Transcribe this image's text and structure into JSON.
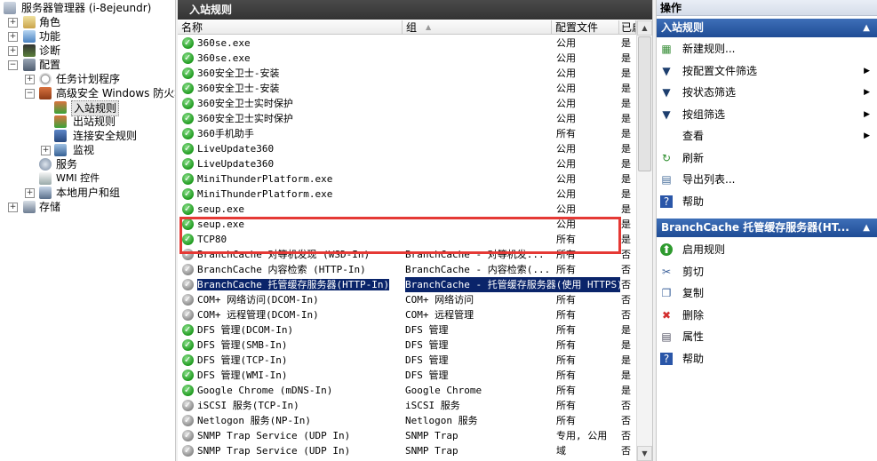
{
  "tree": {
    "root": "服务器管理器 (i-8ejeundr)",
    "items": [
      "角色",
      "功能",
      "诊断",
      "配置",
      "任务计划程序",
      "高级安全 Windows 防火墙",
      "入站规则",
      "出站规则",
      "连接安全规则",
      "监视",
      "服务",
      "WMI 控件",
      "本地用户和组",
      "存储"
    ]
  },
  "center": {
    "title": "入站规则",
    "columns": [
      "名称",
      "组",
      "配置文件",
      "已启用"
    ],
    "rows": [
      {
        "name": "360se.exe",
        "group": "",
        "profile": "公用",
        "enabled": "是",
        "icon": "ok"
      },
      {
        "name": "360se.exe",
        "group": "",
        "profile": "公用",
        "enabled": "是",
        "icon": "ok"
      },
      {
        "name": "360安全卫士-安装",
        "group": "",
        "profile": "公用",
        "enabled": "是",
        "icon": "ok"
      },
      {
        "name": "360安全卫士-安装",
        "group": "",
        "profile": "公用",
        "enabled": "是",
        "icon": "ok"
      },
      {
        "name": "360安全卫士实时保护",
        "group": "",
        "profile": "公用",
        "enabled": "是",
        "icon": "ok"
      },
      {
        "name": "360安全卫士实时保护",
        "group": "",
        "profile": "公用",
        "enabled": "是",
        "icon": "ok"
      },
      {
        "name": "360手机助手",
        "group": "",
        "profile": "所有",
        "enabled": "是",
        "icon": "ok"
      },
      {
        "name": "LiveUpdate360",
        "group": "",
        "profile": "公用",
        "enabled": "是",
        "icon": "ok"
      },
      {
        "name": "LiveUpdate360",
        "group": "",
        "profile": "公用",
        "enabled": "是",
        "icon": "ok"
      },
      {
        "name": "MiniThunderPlatform.exe",
        "group": "",
        "profile": "公用",
        "enabled": "是",
        "icon": "ok"
      },
      {
        "name": "MiniThunderPlatform.exe",
        "group": "",
        "profile": "公用",
        "enabled": "是",
        "icon": "ok"
      },
      {
        "name": "seup.exe",
        "group": "",
        "profile": "公用",
        "enabled": "是",
        "icon": "ok"
      },
      {
        "name": "seup.exe",
        "group": "",
        "profile": "公用",
        "enabled": "是",
        "icon": "ok"
      },
      {
        "name": "TCP80",
        "group": "",
        "profile": "所有",
        "enabled": "是",
        "icon": "ok"
      },
      {
        "name": "BranchCache 对等机发现 (WSD-In)",
        "group": "BranchCache - 对等机发...",
        "profile": "所有",
        "enabled": "否",
        "icon": "gray"
      },
      {
        "name": "BranchCache 内容检索 (HTTP-In)",
        "group": "BranchCache - 内容检索(...",
        "profile": "所有",
        "enabled": "否",
        "icon": "gray"
      },
      {
        "name": "BranchCache 托管缓存服务器(HTTP-In)",
        "group": "BranchCache - 托管缓存服务器(使用 HTTPS)",
        "profile": "",
        "enabled": "否",
        "icon": "gray",
        "selected": true
      },
      {
        "name": "COM+ 网络访问(DCOM-In)",
        "group": "COM+ 网络访问",
        "profile": "所有",
        "enabled": "否",
        "icon": "gray"
      },
      {
        "name": "COM+ 远程管理(DCOM-In)",
        "group": "COM+ 远程管理",
        "profile": "所有",
        "enabled": "否",
        "icon": "gray"
      },
      {
        "name": "DFS 管理(DCOM-In)",
        "group": "DFS 管理",
        "profile": "所有",
        "enabled": "是",
        "icon": "ok"
      },
      {
        "name": "DFS 管理(SMB-In)",
        "group": "DFS 管理",
        "profile": "所有",
        "enabled": "是",
        "icon": "ok"
      },
      {
        "name": "DFS 管理(TCP-In)",
        "group": "DFS 管理",
        "profile": "所有",
        "enabled": "是",
        "icon": "ok"
      },
      {
        "name": "DFS 管理(WMI-In)",
        "group": "DFS 管理",
        "profile": "所有",
        "enabled": "是",
        "icon": "ok"
      },
      {
        "name": "Google Chrome (mDNS-In)",
        "group": "Google Chrome",
        "profile": "所有",
        "enabled": "是",
        "icon": "ok"
      },
      {
        "name": "iSCSI 服务(TCP-In)",
        "group": "iSCSI 服务",
        "profile": "所有",
        "enabled": "否",
        "icon": "gray"
      },
      {
        "name": "Netlogon 服务(NP-In)",
        "group": "Netlogon 服务",
        "profile": "所有",
        "enabled": "否",
        "icon": "gray"
      },
      {
        "name": "SNMP Trap Service (UDP In)",
        "group": "SNMP Trap",
        "profile": "专用, 公用",
        "enabled": "否",
        "icon": "gray"
      },
      {
        "name": "SNMP Trap Service (UDP In)",
        "group": "SNMP Trap",
        "profile": "域",
        "enabled": "否",
        "icon": "gray"
      }
    ]
  },
  "actions": {
    "title": "操作",
    "section1": "入站规则",
    "section1_items": [
      {
        "label": "新建规则...",
        "icon": "new-rule-icon",
        "arrow": false
      },
      {
        "label": "按配置文件筛选",
        "icon": "filter-icon",
        "arrow": true
      },
      {
        "label": "按状态筛选",
        "icon": "filter-icon",
        "arrow": true
      },
      {
        "label": "按组筛选",
        "icon": "filter-icon",
        "arrow": true
      },
      {
        "label": "查看",
        "icon": "",
        "arrow": true
      },
      {
        "label": "刷新",
        "icon": "refresh-icon",
        "arrow": false
      },
      {
        "label": "导出列表...",
        "icon": "export-icon",
        "arrow": false
      },
      {
        "label": "帮助",
        "icon": "help-icon",
        "arrow": false
      }
    ],
    "section2": "BranchCache 托管缓存服务器(HT...",
    "section2_items": [
      {
        "label": "启用规则",
        "icon": "enable-icon"
      },
      {
        "label": "剪切",
        "icon": "cut-icon"
      },
      {
        "label": "复制",
        "icon": "copy-icon"
      },
      {
        "label": "删除",
        "icon": "delete-icon"
      },
      {
        "label": "属性",
        "icon": "properties-icon"
      },
      {
        "label": "帮助",
        "icon": "help-icon"
      }
    ]
  }
}
